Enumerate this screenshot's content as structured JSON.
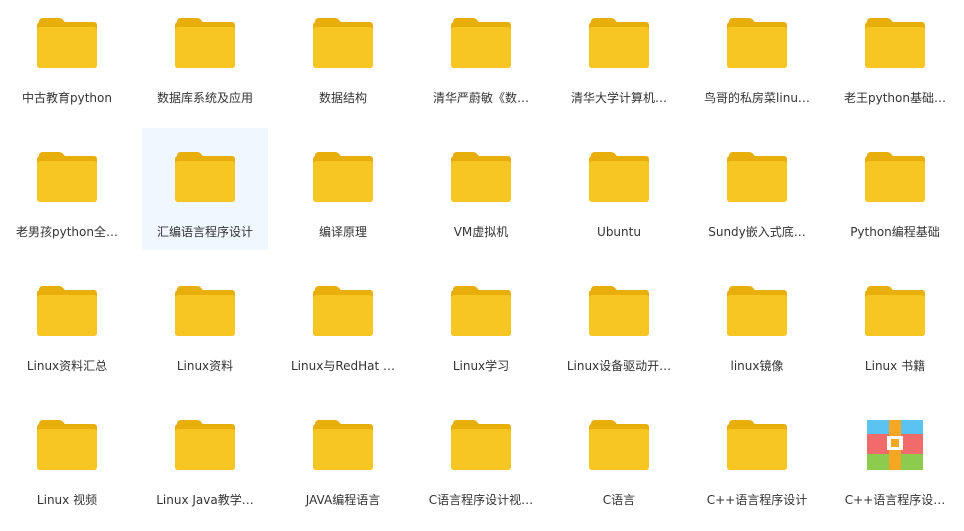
{
  "colors": {
    "folder_body": "#F8C623",
    "folder_tab": "#E8AE0C",
    "selected_bg": "#F0F7FF",
    "label_text": "#333333"
  },
  "items": [
    {
      "label": "中古教育python",
      "icon": "folder-icon"
    },
    {
      "label": "数据库系统及应用",
      "icon": "folder-icon"
    },
    {
      "label": "数据结构",
      "icon": "folder-icon"
    },
    {
      "label": "清华严蔚敏《数…",
      "icon": "folder-icon"
    },
    {
      "label": "清华大学计算机…",
      "icon": "folder-icon"
    },
    {
      "label": "鸟哥的私房菜linu…",
      "icon": "folder-icon"
    },
    {
      "label": "老王python基础…",
      "icon": "folder-icon"
    },
    {
      "label": "老男孩python全…",
      "icon": "folder-icon"
    },
    {
      "label": "汇编语言程序设计",
      "icon": "folder-icon",
      "selected": true
    },
    {
      "label": "编译原理",
      "icon": "folder-icon"
    },
    {
      "label": "VM虚拟机",
      "icon": "folder-icon"
    },
    {
      "label": "Ubuntu",
      "icon": "folder-icon"
    },
    {
      "label": "Sundy嵌入式底…",
      "icon": "folder-icon"
    },
    {
      "label": "Python编程基础",
      "icon": "folder-icon"
    },
    {
      "label": "Linux资料汇总",
      "icon": "folder-icon"
    },
    {
      "label": "Linux资料",
      "icon": "folder-icon"
    },
    {
      "label": "Linux与RedHat …",
      "icon": "folder-icon"
    },
    {
      "label": "Linux学习",
      "icon": "folder-icon"
    },
    {
      "label": "Linux设备驱动开…",
      "icon": "folder-icon"
    },
    {
      "label": "linux镜像",
      "icon": "folder-icon"
    },
    {
      "label": "Linux 书籍",
      "icon": "folder-icon"
    },
    {
      "label": "Linux 视频",
      "icon": "folder-icon"
    },
    {
      "label": "Linux Java教学…",
      "icon": "folder-icon"
    },
    {
      "label": "JAVA编程语言",
      "icon": "folder-icon"
    },
    {
      "label": "C语言程序设计视…",
      "icon": "folder-icon"
    },
    {
      "label": "C语言",
      "icon": "folder-icon"
    },
    {
      "label": "C++语言程序设计",
      "icon": "folder-icon"
    },
    {
      "label": "C++语言程序设…",
      "icon": "archive-icon"
    }
  ]
}
